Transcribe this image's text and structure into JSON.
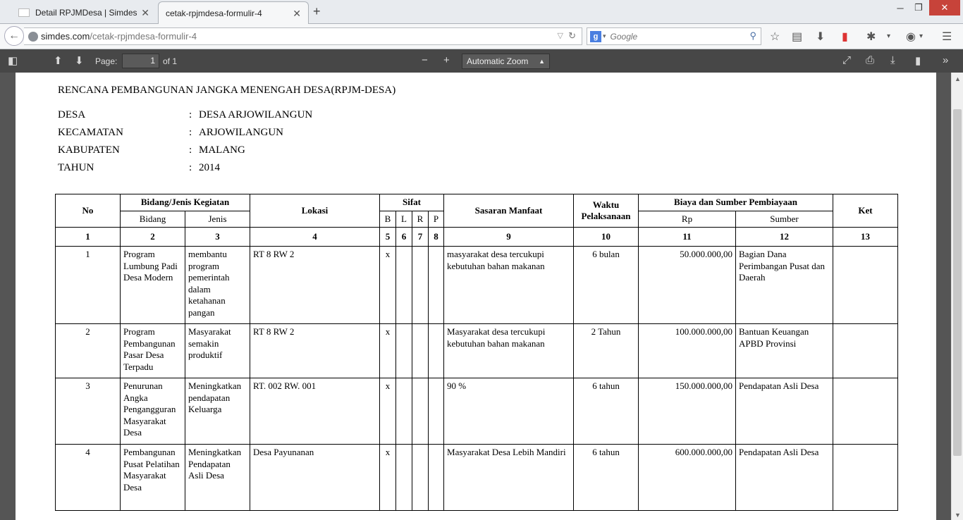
{
  "browser": {
    "tabs": [
      {
        "label": "Detail RPJMDesa | Simdes"
      },
      {
        "label": "cetak-rpjmdesa-formulir-4"
      }
    ],
    "url_host": "simdes.com",
    "url_path": "/cetak-rpjmdesa-formulir-4",
    "search_placeholder": "Google"
  },
  "pdf_toolbar": {
    "page_label": "Page:",
    "page_value": "1",
    "page_total": "of 1",
    "zoom": "Automatic Zoom"
  },
  "document": {
    "title": "RENCANA PEMBANGUNAN JANGKA MENENGAH DESA(RPJM-DESA)",
    "meta": [
      {
        "key": "DESA",
        "value": "DESA ARJOWILANGUN"
      },
      {
        "key": "KECAMATAN",
        "value": "ARJOWILANGUN"
      },
      {
        "key": "KABUPATEN",
        "value": "MALANG"
      },
      {
        "key": "TAHUN",
        "value": "2014"
      }
    ],
    "colon": ":",
    "table": {
      "headers": {
        "no": "No",
        "bidang_jenis": "Bidang/Jenis Kegiatan",
        "bidang": "Bidang",
        "jenis": "Jenis",
        "lokasi": "Lokasi",
        "sifat": "Sifat",
        "b": "B",
        "l": "L",
        "r": "R",
        "p": "P",
        "sasaran": "Sasaran Manfaat",
        "waktu": "Waktu Pelaksanaan",
        "biaya": "Biaya dan Sumber Pembiayaan",
        "rp": "Rp",
        "sumber": "Sumber",
        "ket": "Ket"
      },
      "numbers": [
        "1",
        "2",
        "3",
        "4",
        "5",
        "6",
        "7",
        "8",
        "9",
        "10",
        "11",
        "12",
        "13"
      ],
      "rows": [
        {
          "no": "1",
          "bidang": "Program Lumbung Padi Desa Modern",
          "jenis": "membantu program pemerintah dalam ketahanan pangan",
          "lokasi": "RT 8 RW 2",
          "b": "x",
          "l": "",
          "r": "",
          "p": "",
          "sasaran": "masyarakat desa tercukupi kebutuhan bahan makanan",
          "waktu": "6 bulan",
          "rp": "50.000.000,00",
          "sumber": "Bagian Dana Perimbangan Pusat dan Daerah",
          "ket": ""
        },
        {
          "no": "2",
          "bidang": "Program Pembangunan Pasar Desa Terpadu",
          "jenis": "Masyarakat semakin produktif",
          "lokasi": "RT 8 RW 2",
          "b": "x",
          "l": "",
          "r": "",
          "p": "",
          "sasaran": "Masyarakat desa tercukupi kebutuhan bahan makanan",
          "waktu": "2 Tahun",
          "rp": "100.000.000,00",
          "sumber": "Bantuan Keuangan APBD Provinsi",
          "ket": ""
        },
        {
          "no": "3",
          "bidang": "Penurunan Angka Pengangguran Masyarakat Desa",
          "jenis": "Meningkatkan pendapatan Keluarga",
          "lokasi": "RT. 002 RW. 001",
          "b": "x",
          "l": "",
          "r": "",
          "p": "",
          "sasaran": "90 %",
          "waktu": "6 tahun",
          "rp": "150.000.000,00",
          "sumber": "Pendapatan Asli Desa",
          "ket": ""
        },
        {
          "no": "4",
          "bidang": "Pembangunan Pusat Pelatihan Masyarakat Desa",
          "jenis": "Meningkatkan Pendapatan Asli Desa",
          "lokasi": "Desa Payunanan",
          "b": "x",
          "l": "",
          "r": "",
          "p": "",
          "sasaran": "Masyarakat Desa Lebih Mandiri",
          "waktu": "6 tahun",
          "rp": "600.000.000,00",
          "sumber": "Pendapatan Asli Desa",
          "ket": ""
        }
      ]
    }
  }
}
